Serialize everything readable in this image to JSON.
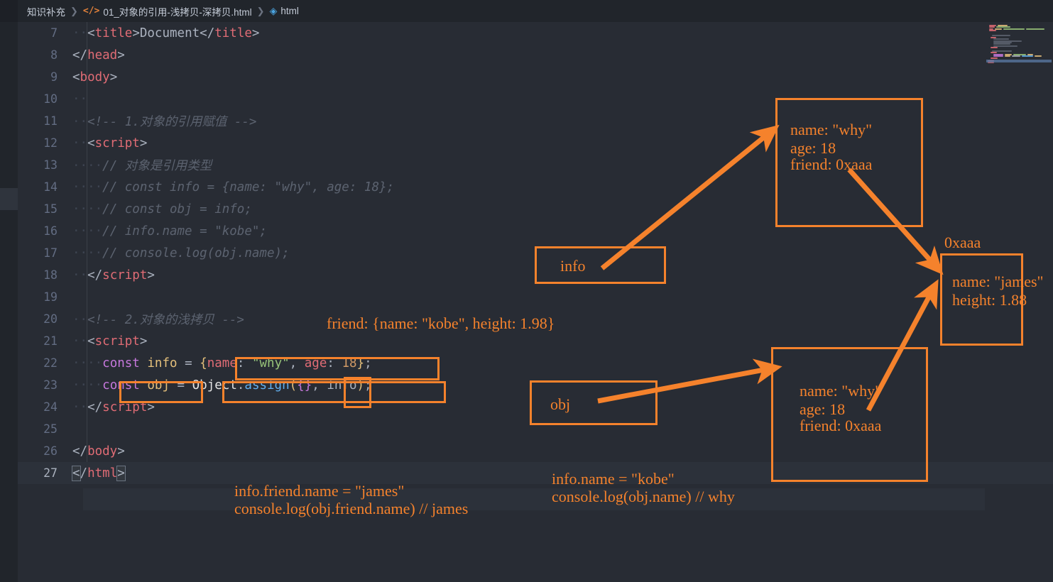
{
  "breadcrumb": {
    "items": [
      {
        "label": "知识补充",
        "icon": "none"
      },
      {
        "label": "01_对象的引用-浅拷贝-深拷贝.html",
        "icon": "code-icon"
      },
      {
        "label": "html",
        "icon": "cube-icon"
      }
    ],
    "separator": "❯"
  },
  "editor": {
    "accent_color": "#f5822c",
    "background": "#282c34",
    "active_line": 27,
    "lines": [
      {
        "num": "7",
        "segments": [
          {
            "t": "  ",
            "c": "ws"
          },
          {
            "t": "<",
            "c": "punc"
          },
          {
            "t": "title",
            "c": "tag"
          },
          {
            "t": ">",
            "c": "punc"
          },
          {
            "t": "Document",
            "c": "txt"
          },
          {
            "t": "</",
            "c": "punc"
          },
          {
            "t": "title",
            "c": "tag"
          },
          {
            "t": ">",
            "c": "punc"
          }
        ]
      },
      {
        "num": "8",
        "segments": [
          {
            "t": "</",
            "c": "punc"
          },
          {
            "t": "head",
            "c": "tag"
          },
          {
            "t": ">",
            "c": "punc"
          }
        ]
      },
      {
        "num": "9",
        "segments": [
          {
            "t": "<",
            "c": "punc"
          },
          {
            "t": "body",
            "c": "tag"
          },
          {
            "t": ">",
            "c": "punc"
          }
        ]
      },
      {
        "num": "10",
        "segments": [
          {
            "t": "  ",
            "c": "ws"
          }
        ]
      },
      {
        "num": "11",
        "segments": [
          {
            "t": "  ",
            "c": "ws"
          },
          {
            "t": "<!-- 1.对象的引用赋值 -->",
            "c": "cmt"
          }
        ]
      },
      {
        "num": "12",
        "segments": [
          {
            "t": "  ",
            "c": "ws"
          },
          {
            "t": "<",
            "c": "punc"
          },
          {
            "t": "script",
            "c": "tag"
          },
          {
            "t": ">",
            "c": "punc"
          }
        ]
      },
      {
        "num": "13",
        "segments": [
          {
            "t": "    ",
            "c": "ws"
          },
          {
            "t": "// 对象是引用类型",
            "c": "cmt"
          }
        ]
      },
      {
        "num": "14",
        "segments": [
          {
            "t": "    ",
            "c": "ws"
          },
          {
            "t": "// const info = {name: \"why\", age: 18};",
            "c": "cmt"
          }
        ]
      },
      {
        "num": "15",
        "segments": [
          {
            "t": "    ",
            "c": "ws"
          },
          {
            "t": "// const obj = info;",
            "c": "cmt"
          }
        ]
      },
      {
        "num": "16",
        "segments": [
          {
            "t": "    ",
            "c": "ws"
          },
          {
            "t": "// info.name = \"kobe\";",
            "c": "cmt"
          }
        ]
      },
      {
        "num": "17",
        "segments": [
          {
            "t": "    ",
            "c": "ws"
          },
          {
            "t": "// console.log(obj.name);",
            "c": "cmt"
          }
        ]
      },
      {
        "num": "18",
        "segments": [
          {
            "t": "  ",
            "c": "ws"
          },
          {
            "t": "</",
            "c": "punc"
          },
          {
            "t": "script",
            "c": "tag"
          },
          {
            "t": ">",
            "c": "punc"
          }
        ]
      },
      {
        "num": "19",
        "segments": []
      },
      {
        "num": "20",
        "segments": [
          {
            "t": "  ",
            "c": "ws"
          },
          {
            "t": "<!-- 2.对象的浅拷贝 -->",
            "c": "cmt"
          }
        ]
      },
      {
        "num": "21",
        "segments": [
          {
            "t": "  ",
            "c": "ws"
          },
          {
            "t": "<",
            "c": "punc"
          },
          {
            "t": "script",
            "c": "tag"
          },
          {
            "t": ">",
            "c": "punc"
          }
        ]
      },
      {
        "num": "22",
        "segments": [
          {
            "t": "    ",
            "c": "ws"
          },
          {
            "t": "const",
            "c": "kw"
          },
          {
            "t": " ",
            "c": "txt"
          },
          {
            "t": "info",
            "c": "var"
          },
          {
            "t": " ",
            "c": "txt"
          },
          {
            "t": "=",
            "c": "op"
          },
          {
            "t": " ",
            "c": "txt"
          },
          {
            "t": "{",
            "c": "brc"
          },
          {
            "t": "name",
            "c": "prop"
          },
          {
            "t": ":",
            "c": "op"
          },
          {
            "t": " ",
            "c": "txt"
          },
          {
            "t": "\"why\"",
            "c": "str"
          },
          {
            "t": ",",
            "c": "op"
          },
          {
            "t": " ",
            "c": "txt"
          },
          {
            "t": "age",
            "c": "prop"
          },
          {
            "t": ":",
            "c": "op"
          },
          {
            "t": " ",
            "c": "txt"
          },
          {
            "t": "18",
            "c": "num"
          },
          {
            "t": "}",
            "c": "brc"
          },
          {
            "t": ";",
            "c": "op"
          }
        ]
      },
      {
        "num": "23",
        "segments": [
          {
            "t": "    ",
            "c": "ws"
          },
          {
            "t": "const",
            "c": "kw"
          },
          {
            "t": " ",
            "c": "txt"
          },
          {
            "t": "obj",
            "c": "var"
          },
          {
            "t": " ",
            "c": "txt"
          },
          {
            "t": "=",
            "c": "op"
          },
          {
            "t": " ",
            "c": "txt"
          },
          {
            "t": "Object",
            "c": "obj"
          },
          {
            "t": ".",
            "c": "op"
          },
          {
            "t": "assign",
            "c": "fn"
          },
          {
            "t": "(",
            "c": "paren"
          },
          {
            "t": "{}",
            "c": "kw"
          },
          {
            "t": ",",
            "c": "op"
          },
          {
            "t": " ",
            "c": "txt"
          },
          {
            "t": "info",
            "c": "txt"
          },
          {
            "t": ")",
            "c": "paren"
          },
          {
            "t": ";",
            "c": "op"
          }
        ]
      },
      {
        "num": "24",
        "segments": [
          {
            "t": "  ",
            "c": "ws"
          },
          {
            "t": "</",
            "c": "punc"
          },
          {
            "t": "script",
            "c": "tag"
          },
          {
            "t": ">",
            "c": "punc"
          }
        ]
      },
      {
        "num": "25",
        "segments": []
      },
      {
        "num": "26",
        "segments": [
          {
            "t": "</",
            "c": "punc"
          },
          {
            "t": "body",
            "c": "tag"
          },
          {
            "t": ">",
            "c": "punc"
          }
        ]
      },
      {
        "num": "27",
        "segments": [
          {
            "t": "<",
            "c": "punc bmatch"
          },
          {
            "t": "/",
            "c": "punc"
          },
          {
            "t": "html",
            "c": "tag"
          },
          {
            "t": ">",
            "c": "punc bmatch"
          }
        ]
      }
    ]
  },
  "annotations": {
    "memory_blocks": [
      {
        "name": "info-object-block",
        "lines": [
          "name: \"why\"",
          "age: 18",
          "friend: 0xaaa"
        ]
      },
      {
        "name": "obj-object-block",
        "lines": [
          "name: \"why\"",
          "age: 18",
          "friend: 0xaaa"
        ]
      },
      {
        "name": "friend-object-block",
        "address_label": "0xaaa",
        "lines": [
          "name: \"james\"",
          "height: 1.88"
        ]
      }
    ],
    "variable_boxes": [
      {
        "name": "info-variable-box",
        "label": "info"
      },
      {
        "name": "obj-variable-box",
        "label": "obj"
      }
    ],
    "notes": [
      {
        "name": "friend-literal-note",
        "text": "friend: {name: \"kobe\", height: 1.98}"
      },
      {
        "name": "deep-mutation-note-line1",
        "text": "info.friend.name = \"james\""
      },
      {
        "name": "deep-mutation-note-line2",
        "text": "console.log(obj.friend.name) // james"
      },
      {
        "name": "shallow-mutation-note-line1",
        "text": "info.name = \"kobe\""
      },
      {
        "name": "shallow-mutation-note-line2",
        "text": "console.log(obj.name) // why"
      }
    ],
    "code_highlights": [
      {
        "name": "highlight-info-literal"
      },
      {
        "name": "highlight-const-obj"
      },
      {
        "name": "highlight-object-assign"
      },
      {
        "name": "highlight-empty-object"
      }
    ]
  }
}
